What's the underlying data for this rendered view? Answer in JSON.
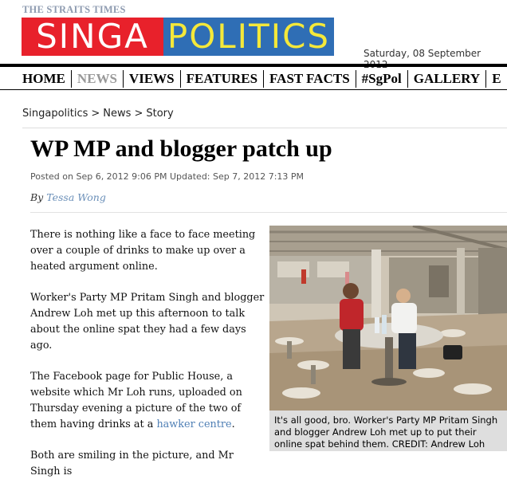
{
  "masthead": {
    "kicker": "THE STRAITS TIMES",
    "logo_part1": "SINGA",
    "logo_part2": "POLITICS",
    "date": "Saturday, 08 September 2012",
    "colors": {
      "red": "#e8212b",
      "blue": "#2f6eb5",
      "yellow": "#f4e83a"
    }
  },
  "nav": {
    "items": [
      "HOME",
      "NEWS",
      "VIEWS",
      "FEATURES",
      "FAST FACTS",
      "#SgPol",
      "GALLERY",
      "E"
    ],
    "active": "NEWS"
  },
  "breadcrumb": [
    "Singapolitics",
    "News",
    "Story"
  ],
  "article": {
    "headline": "WP MP and blogger patch up",
    "meta": "Posted on Sep 6, 2012 9:06 PM Updated: Sep 7, 2012 7:13 PM",
    "byline_prefix": "By",
    "author": "Tessa Wong",
    "paragraphs": [
      "There is nothing like a face to face meeting over a couple of drinks to make up over a heated argument online.",
      "Worker's Party MP Pritam Singh and blogger Andrew Loh met up this afternoon to talk about the online spat they had a few days ago."
    ],
    "p3_before": "The Facebook page for Public House, a website which Mr Loh runs, uploaded on Thursday evening a picture of the two of them having drinks at a",
    "p3_link": "hawker centre",
    "p3_after": ".",
    "p4": "Both are smiling in the picture, and Mr Singh is",
    "photo_caption": "It's all good, bro. Worker's Party MP Pritam Singh and blogger Andrew Loh met up to put their online spat behind them. CREDIT: Andrew Loh"
  }
}
